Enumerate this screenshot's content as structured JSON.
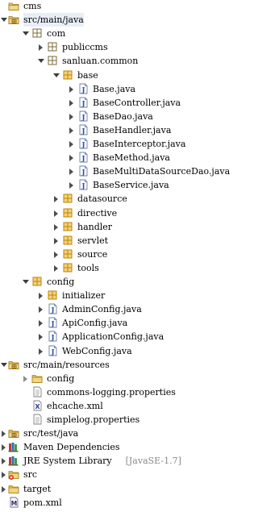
{
  "tree": [
    {
      "label": "cms",
      "depth": 0,
      "icon": "project",
      "state": "none"
    },
    {
      "label": "src/main/java",
      "depth": 0,
      "icon": "source-folder",
      "state": "open",
      "selected": true
    },
    {
      "label": "com",
      "depth": 1,
      "icon": "package",
      "state": "open"
    },
    {
      "label": "publiccms",
      "depth": 2,
      "icon": "package",
      "state": "closed"
    },
    {
      "label": "sanluan.common",
      "depth": 2,
      "icon": "package",
      "state": "open"
    },
    {
      "label": "base",
      "depth": 3,
      "icon": "package-orange",
      "state": "open"
    },
    {
      "label": "Base.java",
      "depth": 4,
      "icon": "java-file",
      "state": "closed"
    },
    {
      "label": "BaseController.java",
      "depth": 4,
      "icon": "java-file",
      "state": "closed"
    },
    {
      "label": "BaseDao.java",
      "depth": 4,
      "icon": "java-file",
      "state": "closed"
    },
    {
      "label": "BaseHandler.java",
      "depth": 4,
      "icon": "java-file",
      "state": "closed"
    },
    {
      "label": "BaseInterceptor.java",
      "depth": 4,
      "icon": "java-file",
      "state": "closed"
    },
    {
      "label": "BaseMethod.java",
      "depth": 4,
      "icon": "java-file",
      "state": "closed"
    },
    {
      "label": "BaseMultiDataSourceDao.java",
      "depth": 4,
      "icon": "java-file",
      "state": "closed"
    },
    {
      "label": "BaseService.java",
      "depth": 4,
      "icon": "java-file",
      "state": "closed"
    },
    {
      "label": "datasource",
      "depth": 3,
      "icon": "package-orange",
      "state": "closed"
    },
    {
      "label": "directive",
      "depth": 3,
      "icon": "package-orange",
      "state": "closed"
    },
    {
      "label": "handler",
      "depth": 3,
      "icon": "package-orange",
      "state": "closed"
    },
    {
      "label": "servlet",
      "depth": 3,
      "icon": "package-orange",
      "state": "closed"
    },
    {
      "label": "source",
      "depth": 3,
      "icon": "package-orange",
      "state": "closed"
    },
    {
      "label": "tools",
      "depth": 3,
      "icon": "package-orange",
      "state": "closed"
    },
    {
      "label": "config",
      "depth": 1,
      "icon": "package-orange",
      "state": "open"
    },
    {
      "label": "initializer",
      "depth": 2,
      "icon": "package-orange",
      "state": "closed"
    },
    {
      "label": "AdminConfig.java",
      "depth": 2,
      "icon": "java-file",
      "state": "closed"
    },
    {
      "label": "ApiConfig.java",
      "depth": 2,
      "icon": "java-file",
      "state": "closed"
    },
    {
      "label": "ApplicationConfig.java",
      "depth": 2,
      "icon": "java-file",
      "state": "closed"
    },
    {
      "label": "WebConfig.java",
      "depth": 2,
      "icon": "java-file",
      "state": "closed"
    },
    {
      "label": "src/main/resources",
      "depth": 0,
      "icon": "source-folder",
      "state": "open"
    },
    {
      "label": "config",
      "depth": 1,
      "icon": "folder",
      "state": "closed",
      "hollow": true
    },
    {
      "label": "commons-logging.properties",
      "depth": 1,
      "icon": "text-file",
      "state": "none"
    },
    {
      "label": "ehcache.xml",
      "depth": 1,
      "icon": "xml-file",
      "state": "none"
    },
    {
      "label": "simplelog.properties",
      "depth": 1,
      "icon": "text-file",
      "state": "none"
    },
    {
      "label": "src/test/java",
      "depth": 0,
      "icon": "source-folder",
      "state": "closed"
    },
    {
      "label": "Maven Dependencies",
      "depth": 0,
      "icon": "library",
      "state": "closed"
    },
    {
      "label": "JRE System Library",
      "suffix": "[JavaSE-1.7]",
      "depth": 0,
      "icon": "library",
      "state": "closed"
    },
    {
      "label": "src",
      "depth": 0,
      "icon": "src-folder",
      "state": "closed"
    },
    {
      "label": "target",
      "depth": 0,
      "icon": "folder",
      "state": "closed"
    },
    {
      "label": "pom.xml",
      "depth": 0,
      "icon": "maven-file",
      "state": "none"
    }
  ]
}
